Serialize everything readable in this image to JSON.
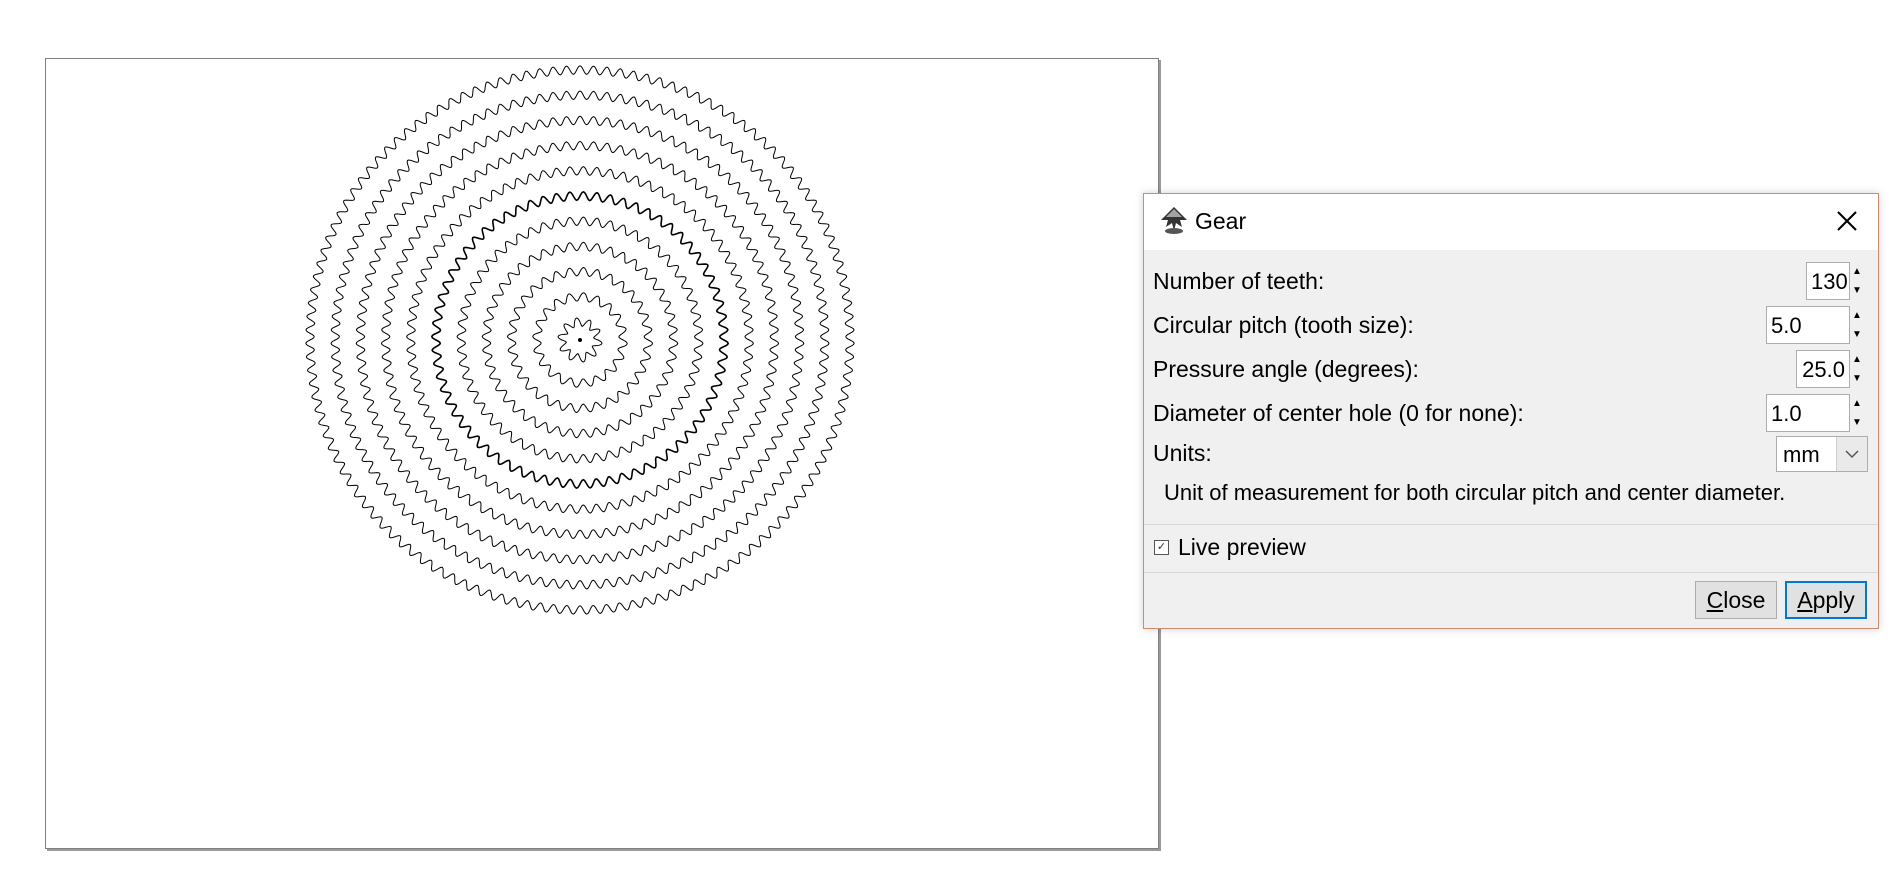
{
  "dialog": {
    "title": "Gear",
    "fields": [
      {
        "label": "Number of teeth:",
        "value": "130"
      },
      {
        "label": "Circular pitch (tooth size):",
        "value": "5.0"
      },
      {
        "label": "Pressure angle (degrees):",
        "value": "25.0"
      },
      {
        "label": "Diameter of center hole (0 for none):",
        "value": "1.0"
      }
    ],
    "units": {
      "label": "Units:",
      "value": "mm"
    },
    "hint": "Unit of measurement for both circular pitch and center diameter.",
    "live_preview": {
      "label": "Live preview",
      "checked": true
    },
    "buttons": {
      "close_first": "C",
      "close_rest": "lose",
      "apply_first": "A",
      "apply_rest": "pply"
    }
  },
  "canvas": {
    "gear_count": 11,
    "stroke_color": "#000000"
  },
  "colors": {
    "dialog_border": "#d08a70",
    "apply_focus": "#0078d7"
  }
}
